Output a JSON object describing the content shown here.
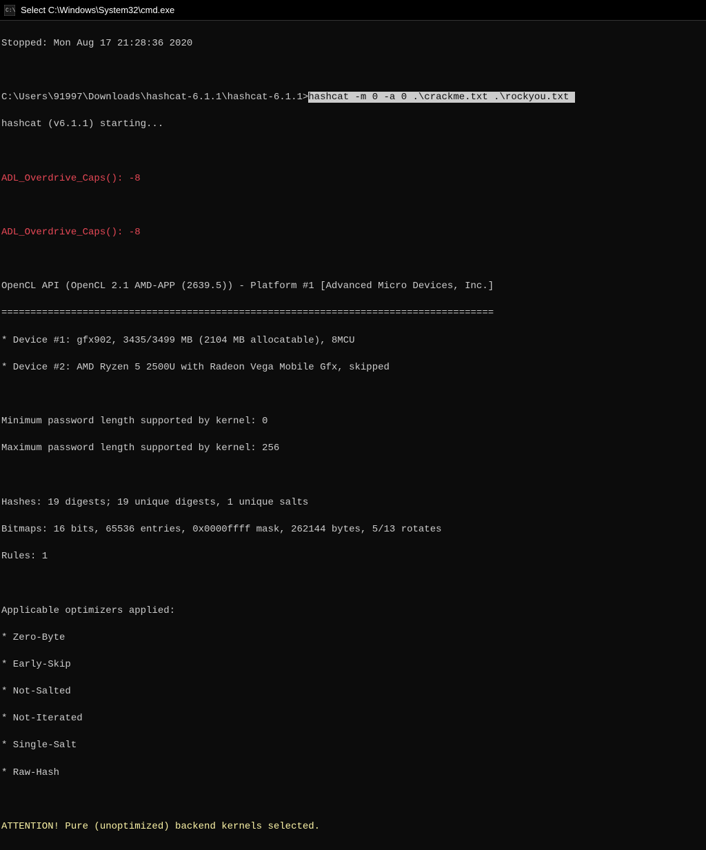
{
  "titlebar": {
    "title": "Select C:\\Windows\\System32\\cmd.exe"
  },
  "terminal": {
    "stopped_line": "Stopped: Mon Aug 17 21:28:36 2020",
    "prompt_path": "C:\\Users\\91997\\Downloads\\hashcat-6.1.1\\hashcat-6.1.1>",
    "command_highlighted": "hashcat -m 0 -a 0 .\\crackme.txt .\\rockyou.txt ",
    "starting_line": "hashcat (v6.1.1) starting...",
    "adl_error_1": "ADL_Overdrive_Caps(): -8",
    "adl_error_2": "ADL_Overdrive_Caps(): -8",
    "opencl_header": "OpenCL API (OpenCL 2.1 AMD-APP (2639.5)) - Platform #1 [Advanced Micro Devices, Inc.]",
    "separator": "=====================================================================================",
    "device_1": "* Device #1: gfx902, 3435/3499 MB (2104 MB allocatable), 8MCU",
    "device_2": "* Device #2: AMD Ryzen 5 2500U with Radeon Vega Mobile Gfx, skipped",
    "min_pass": "Minimum password length supported by kernel: 0",
    "max_pass": "Maximum password length supported by kernel: 256",
    "hashes": "Hashes: 19 digests; 19 unique digests, 1 unique salts",
    "bitmaps": "Bitmaps: 16 bits, 65536 entries, 0x0000ffff mask, 262144 bytes, 5/13 rotates",
    "rules": "Rules: 1",
    "optimizers_header": "Applicable optimizers applied:",
    "opt_1": "* Zero-Byte",
    "opt_2": "* Early-Skip",
    "opt_3": "* Not-Salted",
    "opt_4": "* Not-Iterated",
    "opt_5": "* Single-Salt",
    "opt_6": "* Raw-Hash",
    "attention": "ATTENTION! Pure (unoptimized) backend kernels selected."
  }
}
